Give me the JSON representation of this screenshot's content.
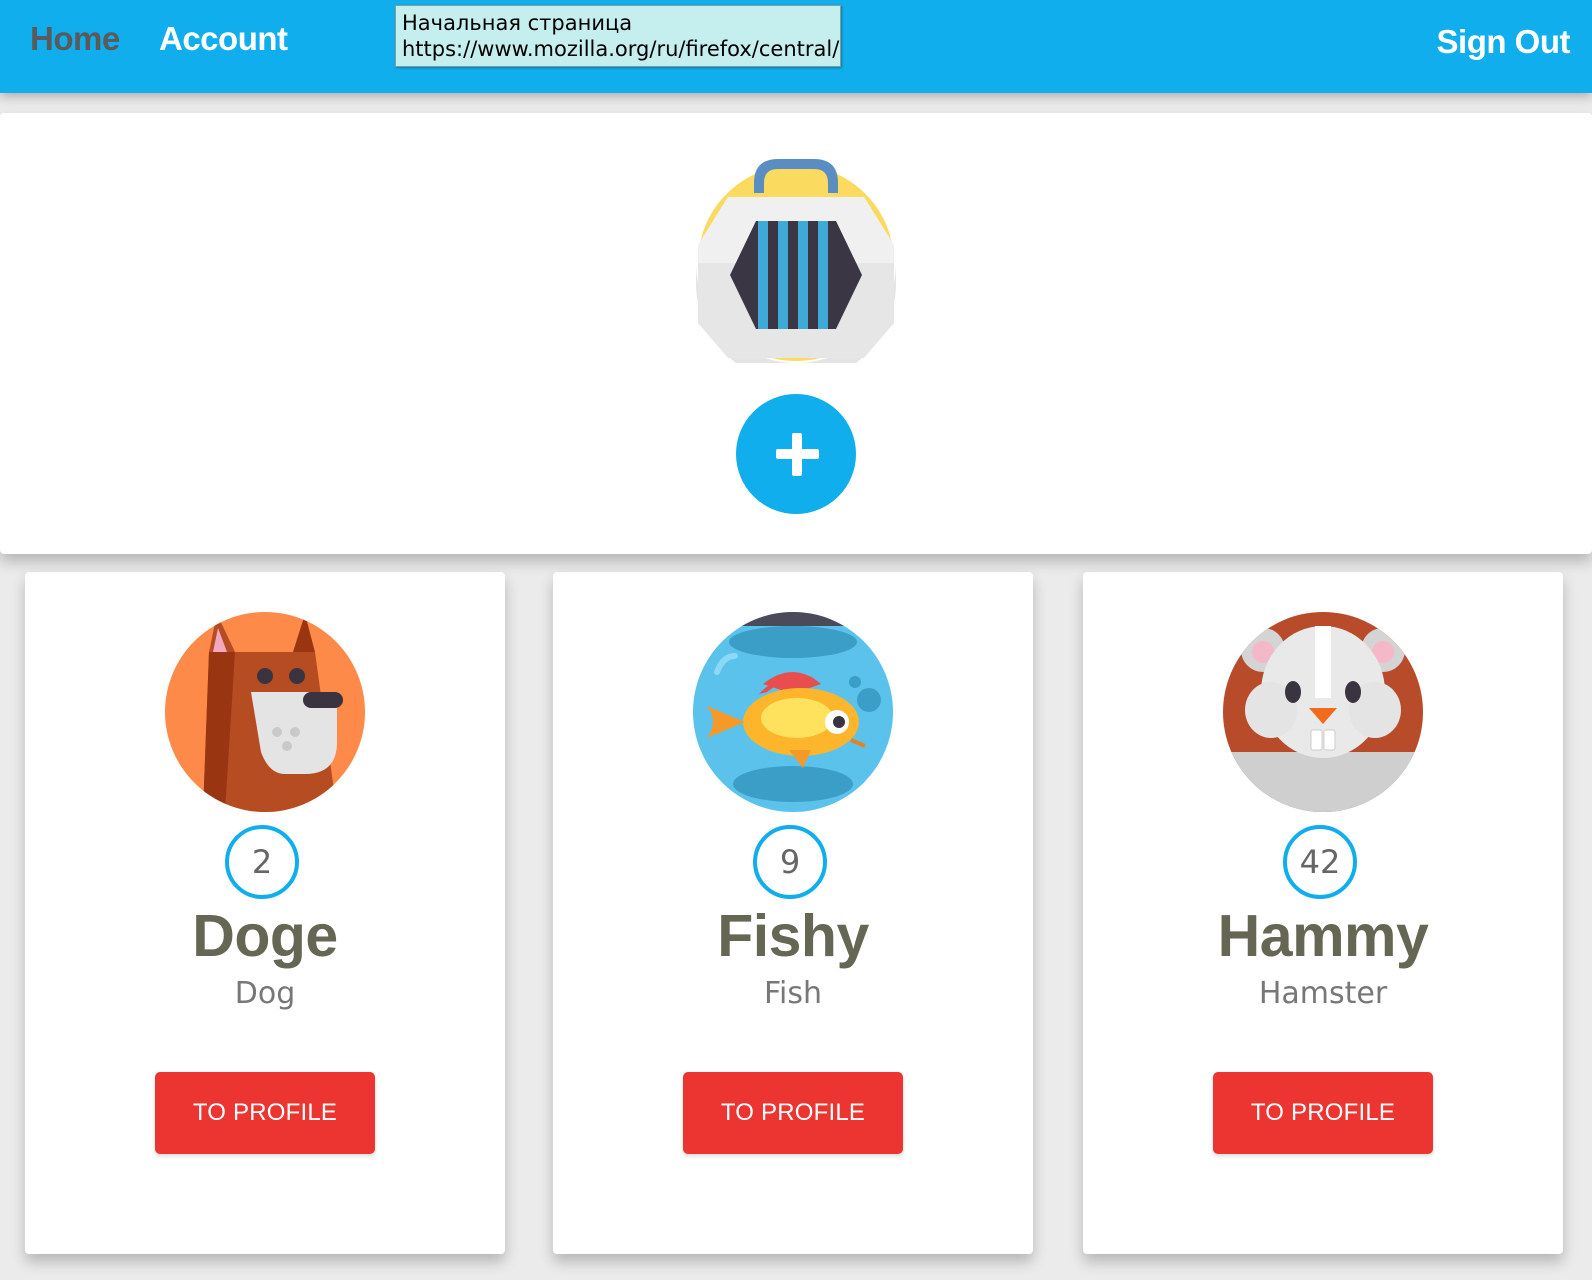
{
  "nav": {
    "home_label": "Home",
    "account_label": "Account",
    "signout_label": "Sign Out"
  },
  "tooltip": {
    "line1": "Начальная страница",
    "line2": "https://www.mozilla.org/ru/firefox/central/"
  },
  "hero": {
    "avatar_icon": "pet-carrier-icon",
    "add_icon": "plus-icon"
  },
  "pets": [
    {
      "age": "2",
      "name": "Doge",
      "species": "Dog",
      "avatar_icon": "dog-icon",
      "button_label": "TO PROFILE"
    },
    {
      "age": "9",
      "name": "Fishy",
      "species": "Fish",
      "avatar_icon": "fish-icon",
      "button_label": "TO PROFILE"
    },
    {
      "age": "42",
      "name": "Hammy",
      "species": "Hamster",
      "avatar_icon": "hamster-icon",
      "button_label": "TO PROFILE"
    }
  ],
  "colors": {
    "primary": "#10aeec",
    "danger": "#ec3431",
    "background": "#ebebeb",
    "home_text": "#5a5a5a",
    "name_text": "#666655"
  }
}
